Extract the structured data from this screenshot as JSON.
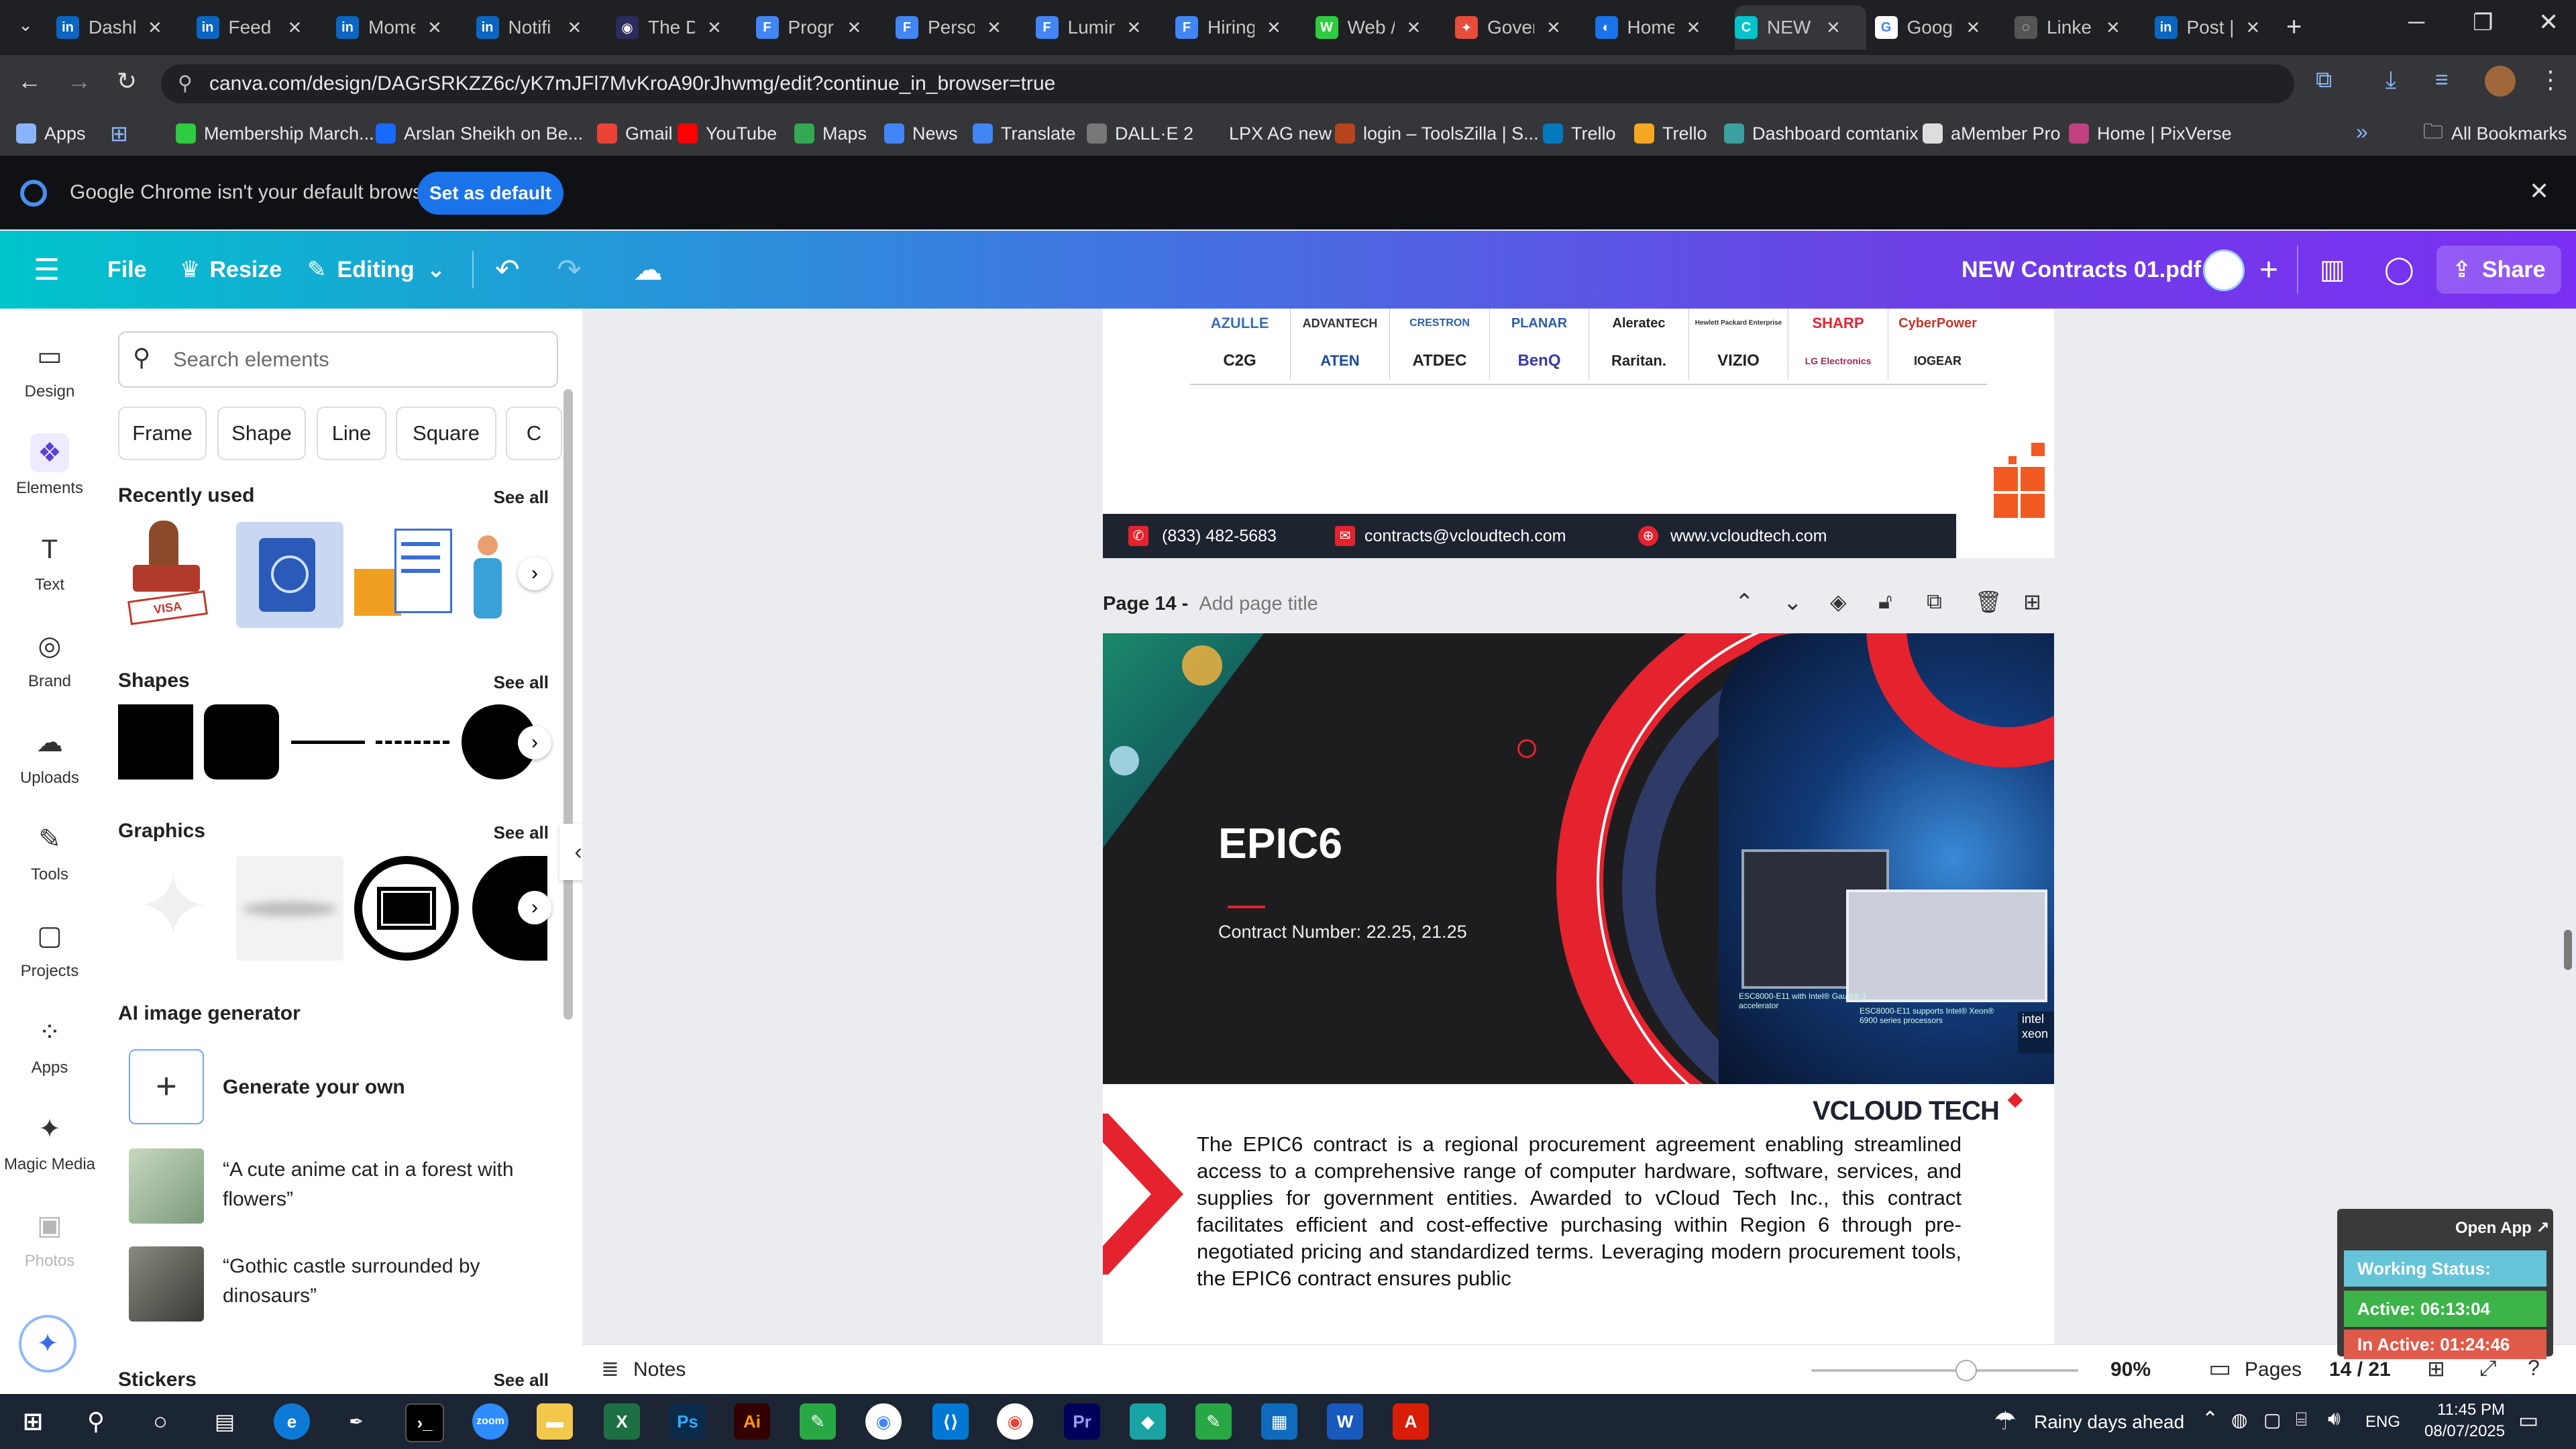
{
  "browser": {
    "tabs": [
      {
        "label": "Dashl",
        "color": "#0a66c2",
        "glyph": "in"
      },
      {
        "label": "Feed |",
        "color": "#0a66c2",
        "glyph": "in"
      },
      {
        "label": "Mome",
        "color": "#0a66c2",
        "glyph": "in"
      },
      {
        "label": "Notifi",
        "color": "#0a66c2",
        "glyph": "in"
      },
      {
        "label": "The D",
        "color": "#2b2b5e",
        "glyph": "◉"
      },
      {
        "label": "Progr",
        "color": "#4285f4",
        "glyph": "F"
      },
      {
        "label": "Perso",
        "color": "#4285f4",
        "glyph": "F"
      },
      {
        "label": "Lumin",
        "color": "#4285f4",
        "glyph": "F"
      },
      {
        "label": "Hiring",
        "color": "#4285f4",
        "glyph": "F"
      },
      {
        "label": "Web /",
        "color": "#2ecc40",
        "glyph": "W"
      },
      {
        "label": "Gover",
        "color": "#e74c3c",
        "glyph": "✦"
      },
      {
        "label": "Home",
        "color": "#1a73e8",
        "glyph": "◐"
      },
      {
        "label": "NEW",
        "color": "#00c4cc",
        "glyph": "C"
      },
      {
        "label": "Googl",
        "color": "#ffffff",
        "glyph": "G"
      },
      {
        "label": "Linke",
        "color": "#555555",
        "glyph": "◌"
      },
      {
        "label": "Post |",
        "color": "#0a66c2",
        "glyph": "in"
      }
    ],
    "url": "canva.com/design/DAGrSRKZZ6c/yK7mJFl7MvKroA90rJhwmg/edit?continue_in_browser=true",
    "bookmarks": [
      {
        "label": "Apps",
        "color": "#8ab4f8"
      },
      {
        "label": "Membership March...",
        "color": "#2ecc40"
      },
      {
        "label": "Arslan Sheikh on Be...",
        "color": "#1769ff"
      },
      {
        "label": "Gmail",
        "color": "#ea4335"
      },
      {
        "label": "YouTube",
        "color": "#ff0000"
      },
      {
        "label": "Maps",
        "color": "#34a853"
      },
      {
        "label": "News",
        "color": "#4285f4"
      },
      {
        "label": "Translate",
        "color": "#4285f4"
      },
      {
        "label": "DALL·E 2",
        "color": "#777777"
      },
      {
        "label": "LPX AG new",
        "color": "#35363a"
      },
      {
        "label": "login – ToolsZilla | S...",
        "color": "#b5451b"
      },
      {
        "label": "Trello",
        "color": "#0079bf"
      },
      {
        "label": "Trello",
        "color": "#f5a623"
      },
      {
        "label": "Dashboard comtanix",
        "color": "#3aa0a0"
      },
      {
        "label": "aMember Pro",
        "color": "#dddddd"
      },
      {
        "label": "Home | PixVerse",
        "color": "#c04080"
      }
    ],
    "all_bookmarks": "All Bookmarks",
    "infobar_text": "Google Chrome isn't your default browser",
    "set_default": "Set as default"
  },
  "canva_header": {
    "file": "File",
    "resize": "Resize",
    "editing": "Editing",
    "doc_title": "NEW Contracts 01.pdf",
    "share": "Share"
  },
  "rail": [
    {
      "label": "Design",
      "icon": "design-icon"
    },
    {
      "label": "Elements",
      "icon": "elements-icon"
    },
    {
      "label": "Text",
      "icon": "text-icon"
    },
    {
      "label": "Brand",
      "icon": "brand-icon"
    },
    {
      "label": "Uploads",
      "icon": "uploads-icon"
    },
    {
      "label": "Tools",
      "icon": "tools-icon"
    },
    {
      "label": "Projects",
      "icon": "projects-icon"
    },
    {
      "label": "Apps",
      "icon": "apps-icon"
    },
    {
      "label": "Magic Media",
      "icon": "magic-media-icon"
    },
    {
      "label": "Photos",
      "icon": "photos-icon"
    }
  ],
  "panel": {
    "search_placeholder": "Search elements",
    "chips": [
      "Frame",
      "Shape",
      "Line",
      "Square",
      "C"
    ],
    "recently_used": "Recently used",
    "shapes": "Shapes",
    "graphics": "Graphics",
    "ai_generator": "AI image generator",
    "generate_own": "Generate your own",
    "prompt1": "“A cute anime cat in a forest with flowers”",
    "prompt2": "“Gothic castle surrounded by dinosaurs”",
    "stickers": "Stickers",
    "see_all": "See all"
  },
  "page13": {
    "logos_row1": [
      "AZULLE",
      "ADVANTECH",
      "CRESTRON",
      "PLANAR",
      "Aleratec",
      "Hewlett Packard Enterprise",
      "SHARP",
      "CyberPower"
    ],
    "logos_row2": [
      "C2G",
      "ATEN",
      "ATDEC",
      "BenQ",
      "Raritan.",
      "VIZIO",
      "LG Electronics",
      "IOGEAR"
    ],
    "phone": "(833) 482-5683",
    "email": "contracts@vcloudtech.com",
    "website": "www.vcloudtech.com"
  },
  "page14": {
    "label": "Page 14 -",
    "title_placeholder": "Add page title",
    "heading": "EPIC6",
    "contract_number": "Contract Number: 22.25, 21.25",
    "brand": "VCLOUD TECH",
    "server_caption1": "ESC8000-E11 with Intel® Gaudi® 3 accelerator",
    "server_caption2": "ESC8000-E11 supports Intel® Xeon® 6900 series processors",
    "intel_badge": "intel xeon",
    "body": "The EPIC6 contract is a regional procurement agreement enabling streamlined access to a comprehensive range of computer hardware, software, services, and supplies for government entities. Awarded to vCloud Tech Inc., this contract facilitates efficient and cost-effective purchasing within Region 6 through pre-negotiated pricing and standardized terms. Leveraging modern procurement tools, the EPIC6 contract ensures public"
  },
  "bottom_bar": {
    "notes": "Notes",
    "zoom": "90%",
    "zoom_level": 0.58,
    "pages": "Pages",
    "page_count": "14 / 21"
  },
  "status_widget": {
    "open_app": "Open App ↗",
    "working": "Working Status: Active",
    "active": "Active: 06:13:04",
    "inactive": "In Active: 01:24:46"
  },
  "taskbar": {
    "weather": "Rainy days ahead",
    "lang": "ENG",
    "time": "11:45 PM",
    "date": "08/07/2025"
  }
}
